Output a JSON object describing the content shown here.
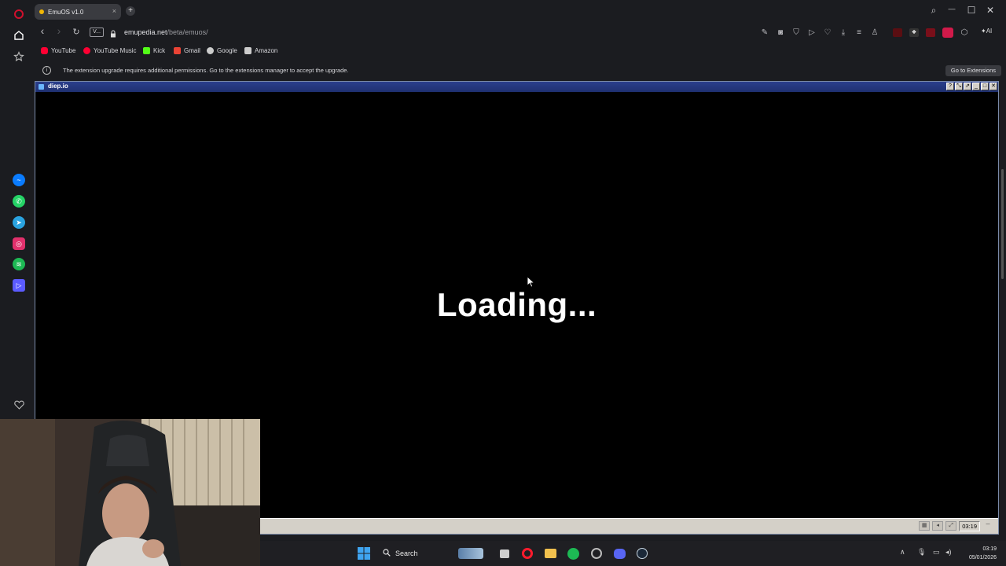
{
  "browser": {
    "tab": {
      "title": "EmuOS v1.0",
      "close": "×"
    },
    "new_tab": "+",
    "window_controls": {
      "search": "⌕",
      "minimize": "—",
      "maximize": "☐",
      "close": "✕"
    },
    "nav": {
      "back": "‹",
      "forward": "›",
      "reload": "↻",
      "vpn_badge": "V..."
    },
    "url": {
      "domain": "emupedia.net",
      "path": "/beta/emuos/"
    },
    "toolbar_icons": [
      "snapshot-icon",
      "camera-icon",
      "shield-icon",
      "play-icon",
      "heart-icon",
      "download-icon",
      "menu-icon",
      "profile-icon"
    ],
    "ai_label": "AI",
    "bookmarks": [
      {
        "label": "YouTube",
        "color": "#ff0033"
      },
      {
        "label": "YouTube Music",
        "color": "#ff0033"
      },
      {
        "label": "Kick",
        "color": "#53fc18"
      },
      {
        "label": "Gmail",
        "color": "#ea4335"
      },
      {
        "label": "Google",
        "color": "#cccccc"
      },
      {
        "label": "Amazon",
        "color": "#cccccc"
      }
    ],
    "infobar": {
      "icon": "i",
      "message": "The extension upgrade requires additional permissions. Go to the extensions manager to accept the upgrade.",
      "button": "Go to Extensions"
    }
  },
  "sidebar": {
    "apps": [
      "home-icon",
      "star-icon",
      "messenger-icon",
      "whatsapp-icon",
      "telegram-icon",
      "instagram-icon",
      "spotify-icon",
      "player-icon",
      "heart-icon"
    ],
    "colors": {
      "messenger": "#0a7cff",
      "whatsapp": "#25d366",
      "telegram": "#2aa3e0",
      "instagram": "#e1306c",
      "spotify": "#1db954",
      "player": "#5b5bff"
    }
  },
  "emu_window": {
    "title": "diep.io",
    "controls": [
      "?",
      "⤡",
      "⇗",
      "_",
      "□",
      "✕"
    ],
    "loading_text": "Loading...",
    "clock": "03:19"
  },
  "windows_taskbar": {
    "search_label": "Search",
    "time": "03:19",
    "date": "05/01/2026",
    "tray_up": "∧"
  }
}
